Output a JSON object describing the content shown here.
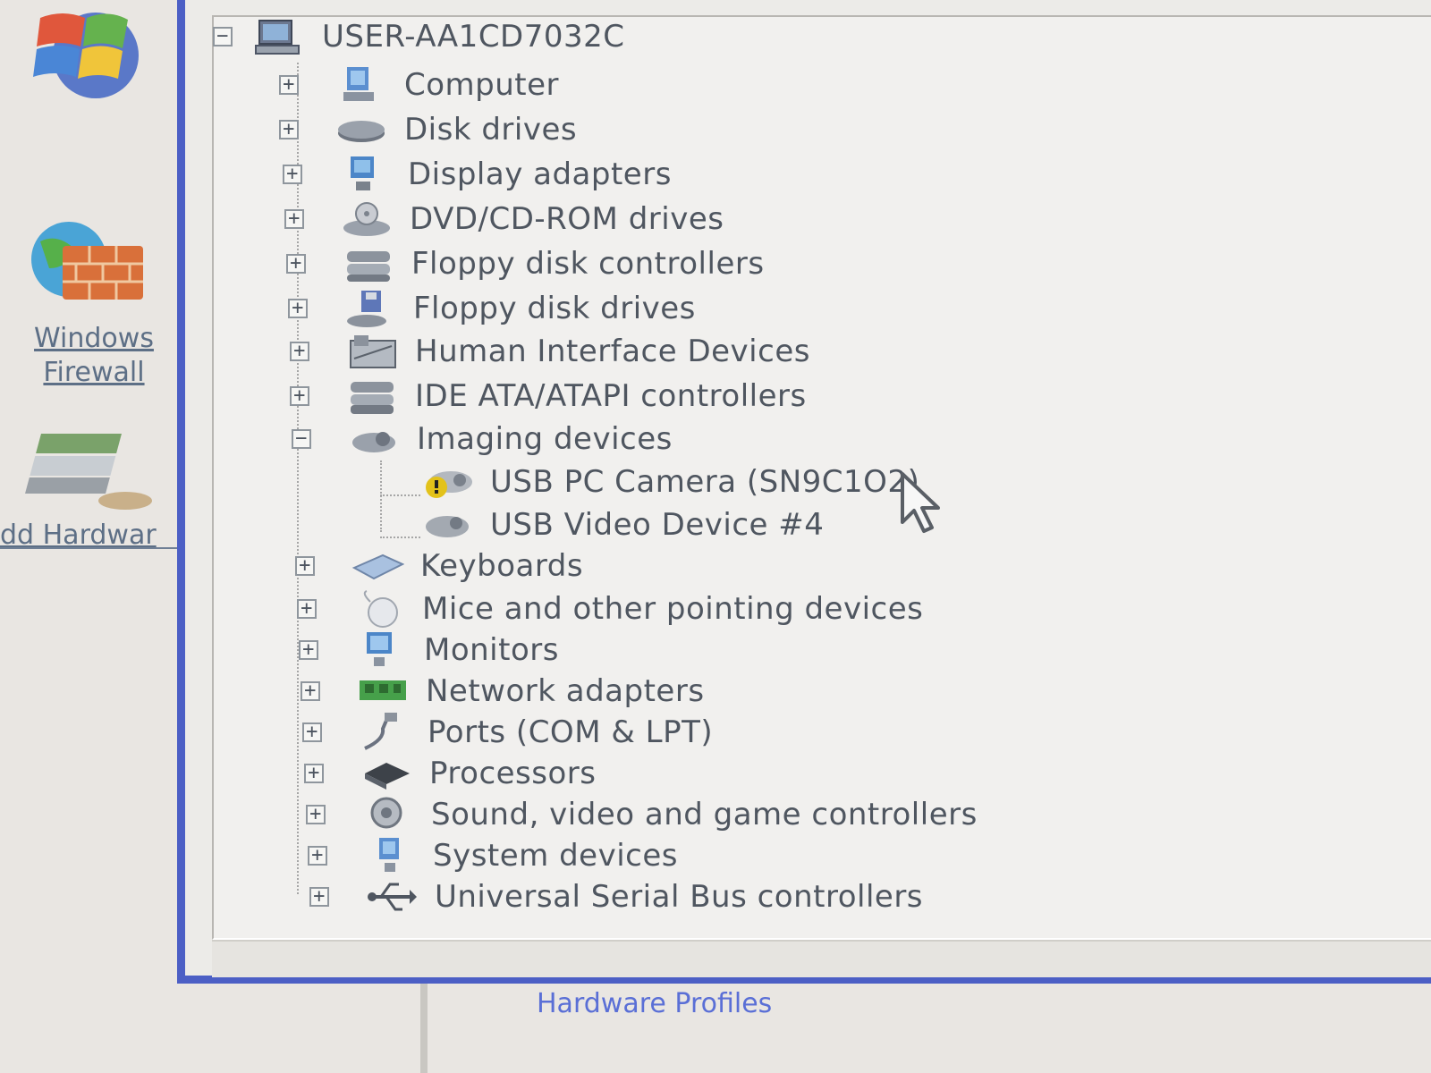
{
  "desktop": {
    "firewall_label_1": "Windows",
    "firewall_label_2": "Firewall",
    "add_hardware_label": "dd Hardwar"
  },
  "tree": {
    "root": "USER-AA1CD7032C",
    "items": [
      {
        "label": "Computer",
        "icon": "computer-icon",
        "expanded": false
      },
      {
        "label": "Disk drives",
        "icon": "disk-drive-icon",
        "expanded": false
      },
      {
        "label": "Display adapters",
        "icon": "display-adapter-icon",
        "expanded": false
      },
      {
        "label": "DVD/CD-ROM drives",
        "icon": "dvd-drive-icon",
        "expanded": false
      },
      {
        "label": "Floppy disk controllers",
        "icon": "floppy-controller-icon",
        "expanded": false
      },
      {
        "label": "Floppy disk drives",
        "icon": "floppy-drive-icon",
        "expanded": false
      },
      {
        "label": "Human Interface Devices",
        "icon": "hid-icon",
        "expanded": false
      },
      {
        "label": "IDE ATA/ATAPI controllers",
        "icon": "ide-controller-icon",
        "expanded": false
      },
      {
        "label": "Imaging devices",
        "icon": "imaging-device-icon",
        "expanded": true,
        "children": [
          {
            "label": "USB PC Camera (SN9C1O2)",
            "icon": "camera-warning-icon"
          },
          {
            "label": "USB Video Device #4",
            "icon": "camera-icon"
          }
        ]
      },
      {
        "label": "Keyboards",
        "icon": "keyboard-icon",
        "expanded": false
      },
      {
        "label": "Mice and other pointing devices",
        "icon": "mouse-icon",
        "expanded": false
      },
      {
        "label": "Monitors",
        "icon": "monitor-icon",
        "expanded": false
      },
      {
        "label": "Network adapters",
        "icon": "network-adapter-icon",
        "expanded": false
      },
      {
        "label": "Ports (COM & LPT)",
        "icon": "port-icon",
        "expanded": false
      },
      {
        "label": "Processors",
        "icon": "processor-icon",
        "expanded": false
      },
      {
        "label": "Sound, video and game controllers",
        "icon": "sound-icon",
        "expanded": false
      },
      {
        "label": "System devices",
        "icon": "system-device-icon",
        "expanded": false
      },
      {
        "label": "Universal Serial Bus controllers",
        "icon": "usb-icon",
        "expanded": false
      }
    ]
  },
  "bottom": {
    "hardware_profiles_label": "Hardware Profiles"
  },
  "colors": {
    "window_border": "#4c5fc5",
    "link": "#5a6fd6",
    "warning": "#e3c21a"
  }
}
